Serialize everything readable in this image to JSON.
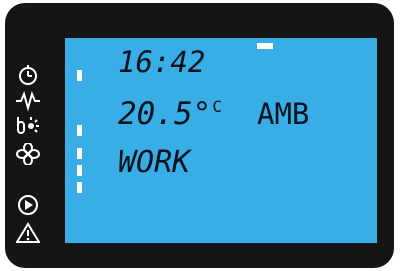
{
  "display": {
    "time": "16:42",
    "temperature_value": "20.5°",
    "temperature_unit": "C",
    "mode_code": "AMB",
    "status": "WORK"
  },
  "icons": [
    "timer-icon",
    "lightning-icon",
    "sun-heat-icon",
    "fan-icon",
    "play-icon",
    "warning-icon"
  ],
  "colors": {
    "bezel": "#151515",
    "lcd_background": "#39ade6",
    "segment_text": "#05131c",
    "indicator": "#ffffff",
    "icon": "#ffffff"
  }
}
